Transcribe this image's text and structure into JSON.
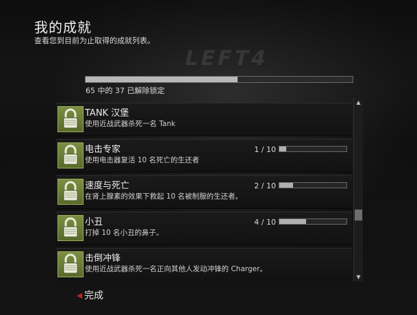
{
  "header": {
    "title": "我的成就",
    "subtitle": "查看您到目前为止取得的成就列表。"
  },
  "progress": {
    "label": "65 中的 37 已解除锁定",
    "unlocked": 37,
    "total": 65
  },
  "achievements": [
    {
      "title": "TANK 汉堡",
      "description": "使用近战武器杀死一名 Tank",
      "icon": "lock-icon",
      "count_text": "",
      "progress": null
    },
    {
      "title": "电击专家",
      "description": "使用电击器复活 10 名死亡的生还者",
      "icon": "lock-icon",
      "count_text": "1 / 10",
      "progress": 0.1
    },
    {
      "title": "速度与死亡",
      "description": "在肾上腺素的效果下救起 10 名被制服的生还者。",
      "icon": "lock-icon",
      "count_text": "2 / 10",
      "progress": 0.2
    },
    {
      "title": "小丑",
      "description": "打掉 10 名小丑的鼻子。",
      "icon": "lock-icon",
      "count_text": "4 / 10",
      "progress": 0.4
    },
    {
      "title": "击倒冲锋",
      "description": "使用近战武器杀死一名正向其他人发动冲锋的 Charger。",
      "icon": "lock-icon",
      "count_text": "",
      "progress": null
    }
  ],
  "footer": {
    "done_label": "完成"
  },
  "colors": {
    "icon_green": "#6b7e37",
    "accent_red": "#c2241f",
    "bar_fill": "#b0b0b0"
  }
}
